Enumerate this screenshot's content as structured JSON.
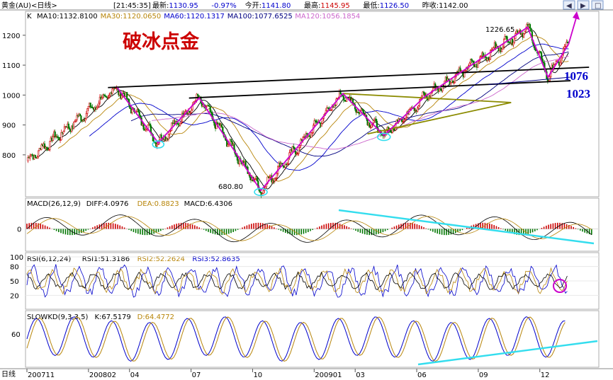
{
  "header": {
    "instrument": "黄金(AU)<日线>",
    "time": "[21:45:35]",
    "fields": [
      {
        "label": "最新:",
        "value": "1130.95",
        "color": "#0000cc"
      },
      {
        "label": "",
        "value": "-0.97%",
        "color": "#0000cc"
      },
      {
        "label": "今开:",
        "value": "1141.80",
        "color": "#0000cc"
      },
      {
        "label": "最高:",
        "value": "1145.95",
        "color": "#cc0000"
      },
      {
        "label": "最低:",
        "value": "1126.50",
        "color": "#0000cc"
      },
      {
        "label": "昨收:",
        "value": "1142.00",
        "color": "#000000"
      }
    ],
    "window_buttons": [
      "◀",
      "▶",
      "□"
    ]
  },
  "panels": {
    "price": {
      "label": "K",
      "ma_legend": [
        {
          "text": "MA10:1132.8100",
          "color": "#000000"
        },
        {
          "text": "MA30:1120.0650",
          "color": "#b8860b"
        },
        {
          "text": "MA60:1120.1317",
          "color": "#0000cc"
        },
        {
          "text": "MA100:1077.6525",
          "color": "#000080"
        },
        {
          "text": "MA120:1056.1854",
          "color": "#cc66cc"
        }
      ]
    },
    "macd": {
      "legend": [
        {
          "text": "MACD(26,12,9)",
          "color": "#000000"
        },
        {
          "text": "DIFF:4.0976",
          "color": "#000000"
        },
        {
          "text": "DEA:0.8823",
          "color": "#b8860b"
        },
        {
          "text": "MACD:6.4306",
          "color": "#000000"
        }
      ],
      "ticks": [
        "0"
      ]
    },
    "rsi": {
      "legend": [
        {
          "text": "RSI(6,12,24)",
          "color": "#000000"
        },
        {
          "text": "RSI1:51.3186",
          "color": "#000000"
        },
        {
          "text": "RSI2:52.2624",
          "color": "#b8860b"
        },
        {
          "text": "RSI3:52.8635",
          "color": "#0000cc"
        }
      ],
      "ticks": [
        "100",
        "80",
        "50",
        "20"
      ]
    },
    "kd": {
      "legend": [
        {
          "text": "SLOWKD(9,3,3,5)",
          "color": "#000000"
        },
        {
          "text": "K:67.5179",
          "color": "#000000"
        },
        {
          "text": "D:64.4772",
          "color": "#b8860b"
        }
      ],
      "ticks": [
        "60"
      ]
    }
  },
  "annotations": {
    "title": "破冰点金",
    "high_label": "1226.65",
    "low_label": "680.80",
    "level_1": "1076",
    "level_2": "1023"
  },
  "x_axis": {
    "label": "日线",
    "ticks": [
      "200711",
      "200802",
      "04",
      "07",
      "10",
      "200901",
      "03",
      "06",
      "09",
      "12"
    ]
  },
  "colors": {
    "up": "#cc0000",
    "down": "#007700",
    "pattern": "#cc00cc",
    "trend_cyan": "#33ddee",
    "blue_text": "#0000cc"
  },
  "chart_data": {
    "type": "line",
    "title": "破冰点金",
    "instrument": "黄金(AU)",
    "x": [
      "200711",
      "200802",
      "04",
      "07",
      "10",
      "200901",
      "03",
      "06",
      "09",
      "12"
    ],
    "y_ticks": [
      800,
      900,
      1000,
      1100,
      1200
    ],
    "ylim": [
      660,
      1280
    ],
    "key_prices": {
      "high": 1226.65,
      "low": 680.8,
      "support_1": 1076,
      "support_2": 1023
    },
    "zigzag_pattern": [
      {
        "x": "200803",
        "y": 1025
      },
      {
        "x": "200805",
        "y": 840
      },
      {
        "x": "200807",
        "y": 990
      },
      {
        "x": "200810",
        "y": 680.8
      },
      {
        "x": "200902",
        "y": 1005
      },
      {
        "x": "200904",
        "y": 865
      },
      {
        "x": "200906",
        "y": 995
      },
      {
        "x": "200911",
        "y": 1226.65
      },
      {
        "x": "200912",
        "y": 1060
      },
      {
        "x": "201001",
        "y": 1170
      }
    ],
    "series": [
      {
        "name": "MA10",
        "values": [
          1132.81
        ]
      },
      {
        "name": "MA30",
        "values": [
          1120.065
        ]
      },
      {
        "name": "MA60",
        "values": [
          1120.1317
        ]
      },
      {
        "name": "MA100",
        "values": [
          1077.6525
        ]
      },
      {
        "name": "MA120",
        "values": [
          1056.1854
        ]
      }
    ],
    "indicators": {
      "MACD(26,12,9)": {
        "DIFF": 4.0976,
        "DEA": 0.8823,
        "MACD": 6.4306
      },
      "RSI(6,12,24)": {
        "RSI1": 51.3186,
        "RSI2": 52.2624,
        "RSI3": 52.8635
      },
      "SLOWKD(9,3,3,5)": {
        "K": 67.5179,
        "D": 64.4772
      }
    }
  }
}
